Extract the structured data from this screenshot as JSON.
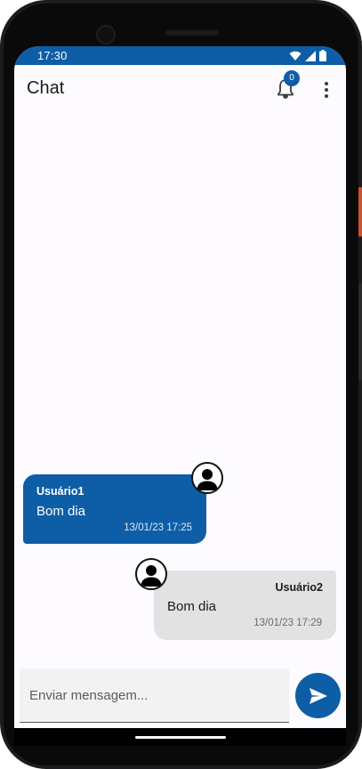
{
  "status_bar": {
    "time": "17:30",
    "icons": [
      "wifi-icon",
      "signal-icon",
      "battery-icon"
    ]
  },
  "app_bar": {
    "title": "Chat",
    "notification_count": "0",
    "icons": [
      "bell-icon",
      "more-vert-icon"
    ]
  },
  "messages": [
    {
      "user": "Usuário1",
      "text": "Bom dia",
      "time": "13/01/23 17:25",
      "side": "left",
      "color": "#0d5ea6"
    },
    {
      "user": "Usuário2",
      "text": "Bom dia",
      "time": "13/01/23 17:29",
      "side": "right",
      "color": "#e2e2e2"
    }
  ],
  "composer": {
    "placeholder": "Enviar mensagem...",
    "value": "",
    "send_icon": "send-icon"
  },
  "colors": {
    "primary": "#0d5ea6",
    "incoming_bubble": "#e2e2e2"
  }
}
